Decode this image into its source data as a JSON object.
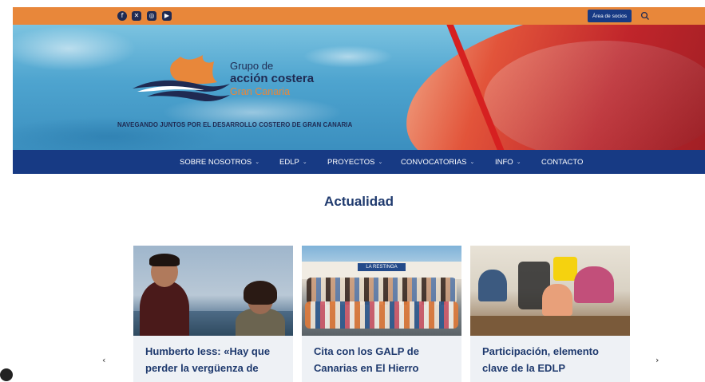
{
  "header": {
    "social_icons": [
      "facebook-icon",
      "x-icon",
      "instagram-icon",
      "youtube-icon"
    ],
    "members_button": "Área de socios",
    "brand": {
      "line1": "Grupo de",
      "line2": "acción costera",
      "line3": "Gran Canaria",
      "tagline": "NAVEGANDO JUNTOS POR EL DESARROLLO COSTERO DE GRAN CANARIA"
    },
    "colors": {
      "topbar": "#e8873a",
      "nav": "#173a84",
      "brand_dark": "#1f2a52",
      "brand_orange": "#e8873a"
    }
  },
  "nav": {
    "items": [
      {
        "label": "SOBRE NOSOTROS",
        "has_dropdown": true
      },
      {
        "label": "EDLP",
        "has_dropdown": true
      },
      {
        "label": "PROYECTOS",
        "has_dropdown": true
      },
      {
        "label": "CONVOCATORIAS",
        "has_dropdown": true
      },
      {
        "label": "INFO",
        "has_dropdown": true
      },
      {
        "label": "CONTACTO",
        "has_dropdown": false
      }
    ]
  },
  "news": {
    "title": "Actualidad",
    "cards": [
      {
        "title": "Humberto Iess: «Hay que perder la vergüenza de"
      },
      {
        "title": "Cita con los GALP de Canarias en El Hierro"
      },
      {
        "title": "Participación, elemento clave de la EDLP"
      }
    ],
    "prev_arrow": "‹",
    "next_arrow": "›",
    "photo2_sign": "LA RESTINGA"
  }
}
